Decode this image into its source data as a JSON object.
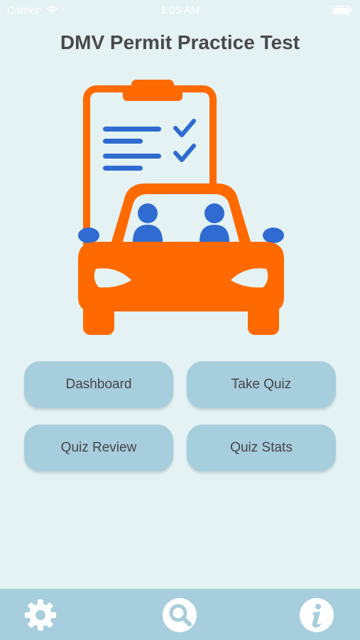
{
  "status_bar": {
    "carrier": "Carrier",
    "time": "1:05 AM",
    "wifi_icon": "wifi-icon",
    "battery_icon": "battery-icon"
  },
  "header": {
    "title": "DMV Permit Practice Test"
  },
  "hero": {
    "illustration": "car-checklist-illustration"
  },
  "menu": {
    "dashboard_label": "Dashboard",
    "take_quiz_label": "Take Quiz",
    "quiz_review_label": "Quiz Review",
    "quiz_stats_label": "Quiz Stats"
  },
  "tab_bar": {
    "settings_icon": "gear-icon",
    "search_icon": "search-icon",
    "info_icon": "info-icon"
  },
  "colors": {
    "background": "#e4f2f3",
    "button": "#a7cedd",
    "accent_orange": "#ff6a00",
    "accent_blue": "#2f6bd1",
    "title_text": "#4a4a4a"
  }
}
